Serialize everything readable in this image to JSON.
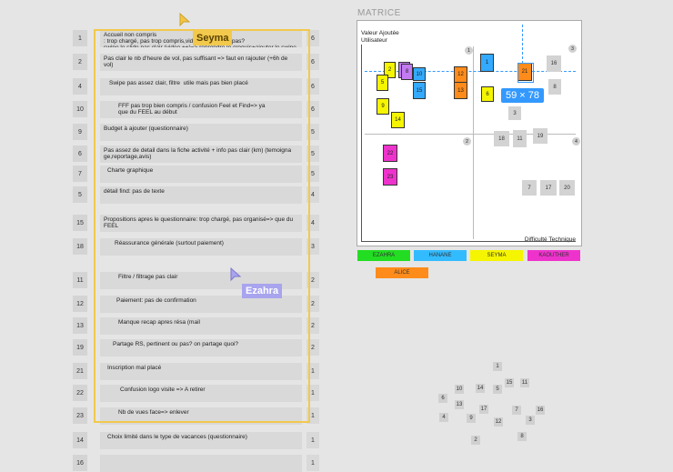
{
  "board": {
    "rows": [
      {
        "num": "1",
        "text": "Accueil non compris\n: trop chargé, pas trop compris,video compris ou pas?\nswipe le slide pas clair (video ++)=> reprendre le croquis+ajouter le swipe",
        "right": "6"
      },
      {
        "num": "2",
        "text": "Pas clair le nb d'heure de vol, pas suffisant => faut en rajouter (+6h de vol)",
        "right": "6"
      },
      {
        "num": "4",
        "text": "Swipe pas assez clair, filtre  utile mais pas bien placé",
        "right": "6"
      },
      {
        "num": "10",
        "text": "FFF pas trop bien compris / confusion Feel et Find=> ya\nque du FEEL au début",
        "right": "6"
      },
      {
        "num": "9",
        "text": "Budget à ajouter (questionnaire)",
        "right": "5"
      },
      {
        "num": "6",
        "text": "Pas assez de detail dans la fiche activité + info pas clair (km) (temoigna\nge,reportage,avis)",
        "right": "5"
      },
      {
        "num": "7",
        "text": "Charte graphique",
        "right": "5"
      },
      {
        "num": "5",
        "text": "détail find: pas de texte",
        "right": "4"
      },
      {
        "num": "15",
        "text": "Propositions apres le questionnaire: trop chargé, pas organisé=> que du FEEL",
        "right": "4"
      },
      {
        "num": "18",
        "text": "Réassurance générale (surtout paiement)",
        "right": "3"
      },
      {
        "num": "11",
        "text": "Filtre / filtrage pas clair",
        "right": "2"
      },
      {
        "num": "12",
        "text": "Paiement: pas de confirmation",
        "right": "2"
      },
      {
        "num": "13",
        "text": "Manque recap apres résa (mail",
        "right": "2"
      },
      {
        "num": "19",
        "text": "Partage RS, pertinent ou pas? on partage quoi?",
        "right": "2"
      },
      {
        "num": "21",
        "text": "Inscription mal placé",
        "right": "1"
      },
      {
        "num": "22",
        "text": "Confusion logo visite => A retirer",
        "right": "1"
      },
      {
        "num": "23",
        "text": "Nb de vues face=> enlever",
        "right": "1"
      },
      {
        "num": "14",
        "text": "Choix limité dans le type de vacances (questionnaire)",
        "right": "1"
      },
      {
        "num": "16",
        "text": "",
        "right": "1"
      }
    ]
  },
  "cursors": {
    "seyma": "Seyma",
    "ezahra": "Ezahra"
  },
  "matrix": {
    "title": "MATRICE",
    "y_label": "Valeur Ajoutée\nUtilisateur",
    "x_label": "Difficulté Technique",
    "selection_size": "59 × 78",
    "quadrants": [
      "1",
      "2",
      "3",
      "4"
    ],
    "stickies": [
      {
        "label": "2",
        "color": "#f5f500"
      },
      {
        "label": "4",
        "color": "#c27bf0"
      },
      {
        "label": "8",
        "color": "#c27bf0"
      },
      {
        "label": "10",
        "color": "#33aaff"
      },
      {
        "label": "5",
        "color": "#f5f500"
      },
      {
        "label": "15",
        "color": "#33aaff"
      },
      {
        "label": "12",
        "color": "#ff8c1a"
      },
      {
        "label": "13",
        "color": "#ff8c1a"
      },
      {
        "label": "1",
        "color": "#33aaff"
      },
      {
        "label": "21",
        "color": "#ff8c1a"
      },
      {
        "label": "6",
        "color": "#f5f500"
      },
      {
        "label": "9",
        "color": "#f5f500"
      },
      {
        "label": "14",
        "color": "#f5f500"
      },
      {
        "label": "22",
        "color": "#ee33cc"
      },
      {
        "label": "23",
        "color": "#ee33cc"
      },
      {
        "label": "16",
        "color": "grey"
      },
      {
        "label": "8",
        "color": "grey"
      },
      {
        "label": "3",
        "color": "grey"
      },
      {
        "label": "18",
        "color": "grey"
      },
      {
        "label": "11",
        "color": "grey"
      },
      {
        "label": "19",
        "color": "grey"
      },
      {
        "label": "7",
        "color": "grey"
      },
      {
        "label": "17",
        "color": "grey"
      },
      {
        "label": "20",
        "color": "grey"
      }
    ]
  },
  "legend": [
    {
      "name": "EZAHRA",
      "color": "#22dd22"
    },
    {
      "name": "HANANE",
      "color": "#33bbff"
    },
    {
      "name": "SEYMA",
      "color": "#f5f500"
    },
    {
      "name": "KAOUTHER",
      "color": "#ee33cc"
    },
    {
      "name": "ALICE",
      "color": "#ff8c1a"
    }
  ],
  "scatter": [
    "1",
    "10",
    "14",
    "5",
    "15",
    "11",
    "6",
    "13",
    "17",
    "7",
    "16",
    "4",
    "9",
    "12",
    "3",
    "2",
    "8"
  ]
}
